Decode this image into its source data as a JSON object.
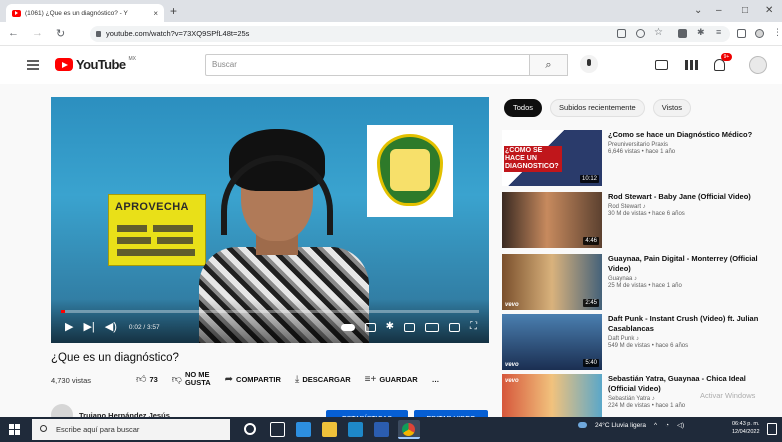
{
  "browser": {
    "tab_title": "(1061) ¿Que es un diagnóstico? - Y",
    "tab_close": "×",
    "new_tab": "+",
    "url": "youtube.com/watch?v=73XQ9SPfL48t=25s",
    "win_min": "–",
    "win_max": "□",
    "win_close": "✕"
  },
  "youtube": {
    "logo_text": "YouTube",
    "region": "MX",
    "search_placeholder": "Buscar",
    "notification_count": "9+"
  },
  "video": {
    "title": "¿Que es un diagnóstico?",
    "time": "0:02 / 3:57",
    "progress": 0.01,
    "views": "4,730 vistas",
    "likes": "73",
    "dislike_label_1": "NO ME",
    "dislike_label_2": "GUSTA",
    "share": "COMPARTIR",
    "download": "DESCARGAR",
    "save": "GUARDAR",
    "more": "…",
    "sign_text": "APROVECHA",
    "channel_name": "Trujano Hernández Jesús",
    "btn_stats": "ESTADÍSTICAS",
    "btn_edit": "EDITAR VIDEO"
  },
  "sidebar": {
    "chips": [
      "Todos",
      "Subidos recientemente",
      "Vistos"
    ],
    "items": [
      {
        "title": "¿Como se hace un Diagnóstico Médico?",
        "channel": "Preuniversitario Praxis",
        "meta": "6,646 vistas • hace 1 año",
        "duration": "10:12",
        "thumb_text": "¿COMO SE HACE UN DIAGNOSTICO?"
      },
      {
        "title": "Rod Stewart - Baby Jane (Official Video)",
        "channel": "Rod Stewart ♪",
        "meta": "30 M de vistas • hace 6 años",
        "duration": "4:46"
      },
      {
        "title": "Guaynaa, Pain Digital - Monterrey (Official Video)",
        "channel": "Guaynaa ♪",
        "meta": "25 M de vistas • hace 1 año",
        "duration": "2:45",
        "vevo": "vevo"
      },
      {
        "title": "Daft Punk - Instant Crush (Video) ft. Julian Casablancas",
        "channel": "Daft Punk ♪",
        "meta": "549 M de vistas • hace 6 años",
        "duration": "5:40",
        "vevo": "vevo"
      },
      {
        "title": "Sebastián Yatra, Guaynaa - Chica Ideal (Official Video)",
        "channel": "Sebastián Yatra ♪",
        "meta": "224 M de vistas • hace 1 año",
        "vevo": "vevo"
      }
    ]
  },
  "watermark": "Activar Windows",
  "taskbar": {
    "search_placeholder": "Escribe aquí para buscar",
    "weather": "24°C  Lluvia ligera",
    "time": "06:43 p. m.",
    "date": "12/04/2022"
  },
  "colors": {
    "accent": "#ff0000",
    "blue": "#065fd4",
    "taskbar": "#1f2a3a"
  }
}
